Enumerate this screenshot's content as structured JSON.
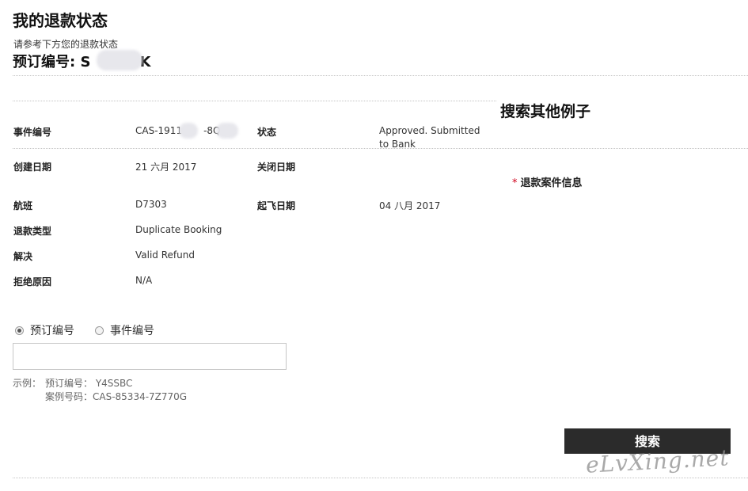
{
  "page": {
    "title": "我的退款状态",
    "instruction": "请参考下方您的退款状态",
    "booking_ref_label": "预订编号: ",
    "booking_ref_start": "S",
    "booking_ref_end": "K"
  },
  "details": {
    "case_number": {
      "label": "事件编号",
      "value_start": "CAS-1911",
      "value_end": "-8Q"
    },
    "status": {
      "label": "状态",
      "value": "Approved. Submitted to Bank"
    },
    "created_date": {
      "label": "创建日期",
      "value": "21 六月 2017"
    },
    "closed_date": {
      "label": "关闭日期",
      "value": ""
    },
    "flight": {
      "label": "航班",
      "value": "D7303"
    },
    "departure_date": {
      "label": "起飞日期",
      "value": "04 八月 2017"
    },
    "refund_type": {
      "label": "退款类型",
      "value": "Duplicate Booking"
    },
    "resolution": {
      "label": "解决",
      "value": "Valid Refund"
    },
    "rejection_reason": {
      "label": "拒绝原因",
      "value": "N/A"
    }
  },
  "sidebar": {
    "title": "搜索其他例子",
    "refund_info_star": "*",
    "refund_info": "退款案件信息"
  },
  "search": {
    "options": [
      {
        "label": "预订编号",
        "selected": true
      },
      {
        "label": "事件编号",
        "selected": false
      }
    ],
    "input_value": "",
    "input_placeholder": "",
    "example_label": "示例：",
    "example_booking": "预订编号： Y4SSBC",
    "example_case": "案例号码：CAS-85334-7Z770G",
    "button_label": "搜索"
  },
  "watermark": "eLvXing.net",
  "colors": {
    "button_bg": "#2b2b2b",
    "required_star": "#d0021b",
    "divider": "#c4c4c4"
  }
}
